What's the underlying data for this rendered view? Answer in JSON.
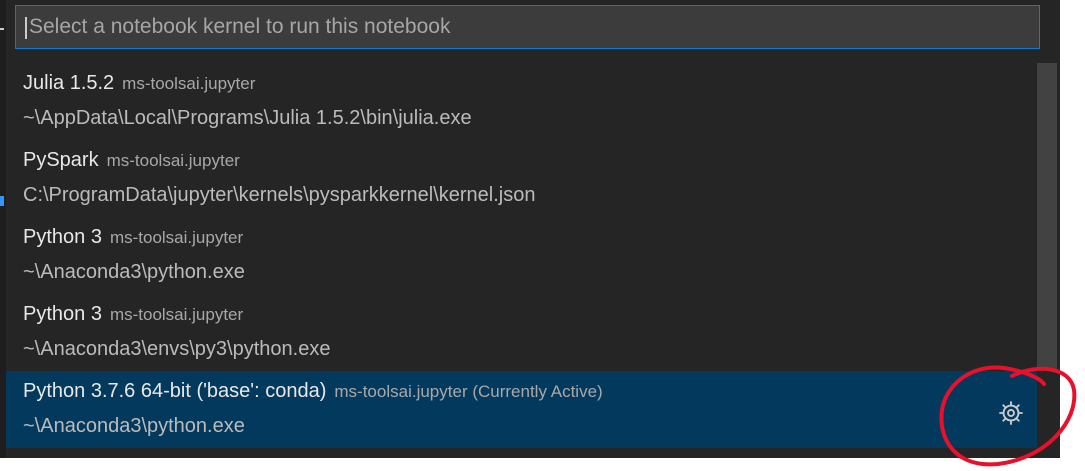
{
  "search": {
    "placeholder": "Select a notebook kernel to run this notebook"
  },
  "kernels": [
    {
      "title": "Julia 1.5.2",
      "description": "ms-toolsai.jupyter",
      "path": "~\\AppData\\Local\\Programs\\Julia 1.5.2\\bin\\julia.exe"
    },
    {
      "title": "PySpark",
      "description": "ms-toolsai.jupyter",
      "path": "C:\\ProgramData\\jupyter\\kernels\\pysparkkernel\\kernel.json"
    },
    {
      "title": "Python 3",
      "description": "ms-toolsai.jupyter",
      "path": "~\\Anaconda3\\python.exe"
    },
    {
      "title": "Python 3",
      "description": "ms-toolsai.jupyter",
      "path": "~\\Anaconda3\\envs\\py3\\python.exe"
    },
    {
      "title": "Python 3.7.6 64-bit ('base': conda)",
      "description": "ms-toolsai.jupyter (Currently Active)",
      "path": "~\\Anaconda3\\python.exe",
      "active": true,
      "action_icon": "gear-icon"
    }
  ],
  "colors": {
    "panel_bg": "#252526",
    "input_bg": "#3c3c3c",
    "focus_border": "#007fd4",
    "active_item_bg": "#04395e",
    "annotation_red": "#e8102a"
  }
}
